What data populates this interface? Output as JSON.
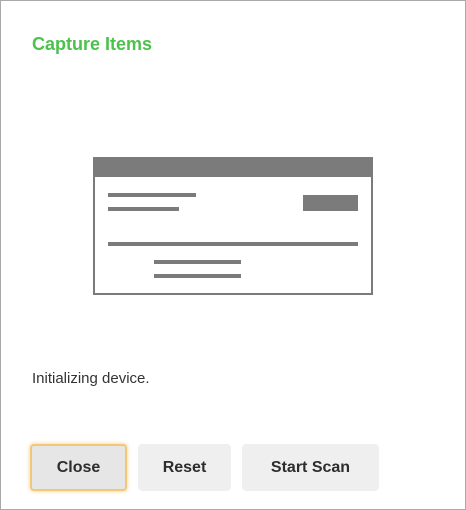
{
  "dialog": {
    "title": "Capture Items",
    "status_text": "Initializing device."
  },
  "illustration": {
    "icon": "check-document-illustration",
    "frame_color": "#777777",
    "line_color": "#777777"
  },
  "buttons": {
    "close_label": "Close",
    "reset_label": "Reset",
    "start_scan_label": "Start Scan"
  },
  "colors": {
    "title": "#4cc24c",
    "focus_ring": "#f3c77a",
    "button_bg": "#efefef"
  }
}
